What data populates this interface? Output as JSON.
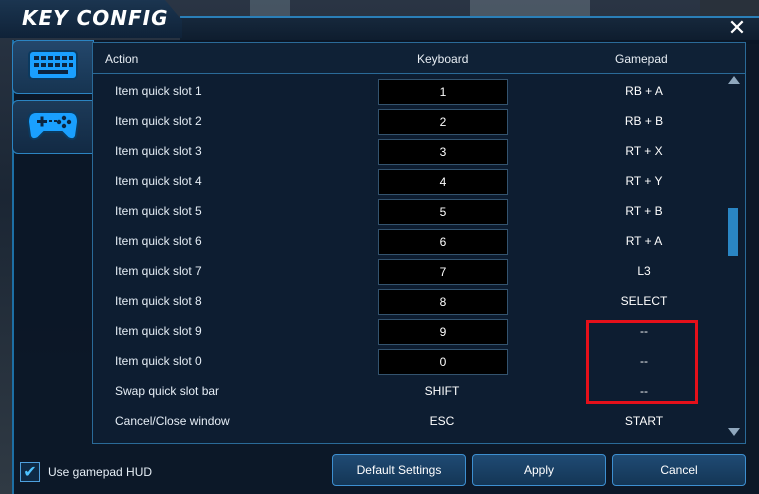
{
  "window": {
    "title": "KEY CONFIG",
    "close": "✕"
  },
  "header": {
    "action": "Action",
    "keyboard": "Keyboard",
    "gamepad": "Gamepad"
  },
  "rows": [
    {
      "action": "Item quick slot 1",
      "keyboard": "1",
      "gamepad": "RB + A"
    },
    {
      "action": "Item quick slot 2",
      "keyboard": "2",
      "gamepad": "RB + B"
    },
    {
      "action": "Item quick slot 3",
      "keyboard": "3",
      "gamepad": "RT + X"
    },
    {
      "action": "Item quick slot 4",
      "keyboard": "4",
      "gamepad": "RT + Y"
    },
    {
      "action": "Item quick slot 5",
      "keyboard": "5",
      "gamepad": "RT + B"
    },
    {
      "action": "Item quick slot 6",
      "keyboard": "6",
      "gamepad": "RT + A"
    },
    {
      "action": "Item quick slot 7",
      "keyboard": "7",
      "gamepad": "L3"
    },
    {
      "action": "Item quick slot 8",
      "keyboard": "8",
      "gamepad": "SELECT"
    },
    {
      "action": "Item quick slot 9",
      "keyboard": "9",
      "gamepad": "--"
    },
    {
      "action": "Item quick slot 0",
      "keyboard": "0",
      "gamepad": "--"
    },
    {
      "action": "Swap quick slot bar",
      "keyboard": "SHIFT",
      "gamepad": "--"
    },
    {
      "action": "Cancel/Close window",
      "keyboard": "ESC",
      "gamepad": "START"
    }
  ],
  "footer": {
    "use_gamepad_hud": "Use gamepad HUD",
    "checkbox_mark": "✔",
    "default_settings": "Default Settings",
    "apply": "Apply",
    "cancel": "Cancel"
  },
  "colors": {
    "accent": "#2a86c4",
    "highlight": "#e5101a"
  }
}
